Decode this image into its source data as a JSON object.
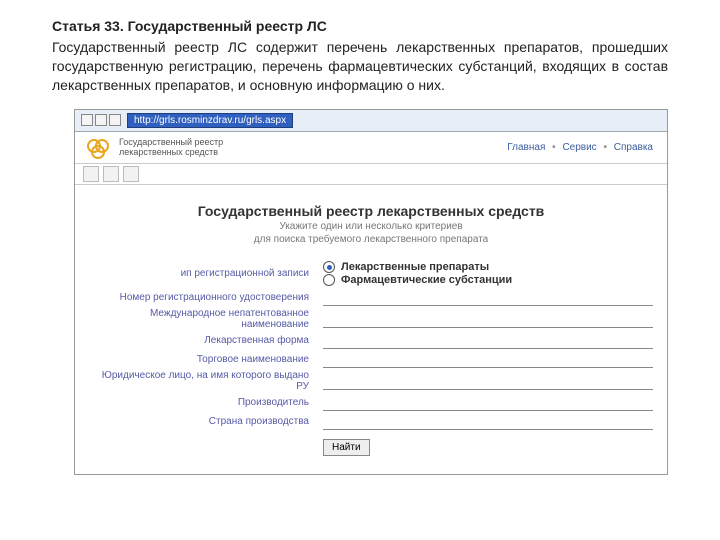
{
  "article": {
    "title": "Статья 33. Государственный реестр ЛС",
    "body": "Государственный реестр ЛС содержит перечень лекарственных препаратов, прошедших государственную регистрацию, перечень фармацевтических субстанций, входящих в состав лекарственных препаратов, и основную информацию о них."
  },
  "browser": {
    "url": "http://grls.rosminzdrav.ru/grls.aspx"
  },
  "site": {
    "logo_line1": "Государственный реестр",
    "logo_line2": "лекарственных средств",
    "nav": {
      "home": "Главная",
      "service": "Сервис",
      "help": "Справка"
    }
  },
  "content": {
    "title": "Государственный реестр лекарственных средств",
    "sub1": "Укажите один или несколько критериев",
    "sub2": "для поиска требуемого лекарственного препарата"
  },
  "form": {
    "radio1": "Лекарственные препараты",
    "radio2": "Фармацевтические субстанции",
    "labels": {
      "tip": "ип регистрационной записи",
      "reg_num": "Номер регистрационного удостоверения",
      "mnn": "Международное непатентованное наименование",
      "form": "Лекарственная форма",
      "trade": "Торговое наименование",
      "holder": "Юридическое лицо, на имя которого выдано РУ",
      "producer": "Производитель",
      "country": "Страна производства"
    },
    "button": "Найти"
  }
}
